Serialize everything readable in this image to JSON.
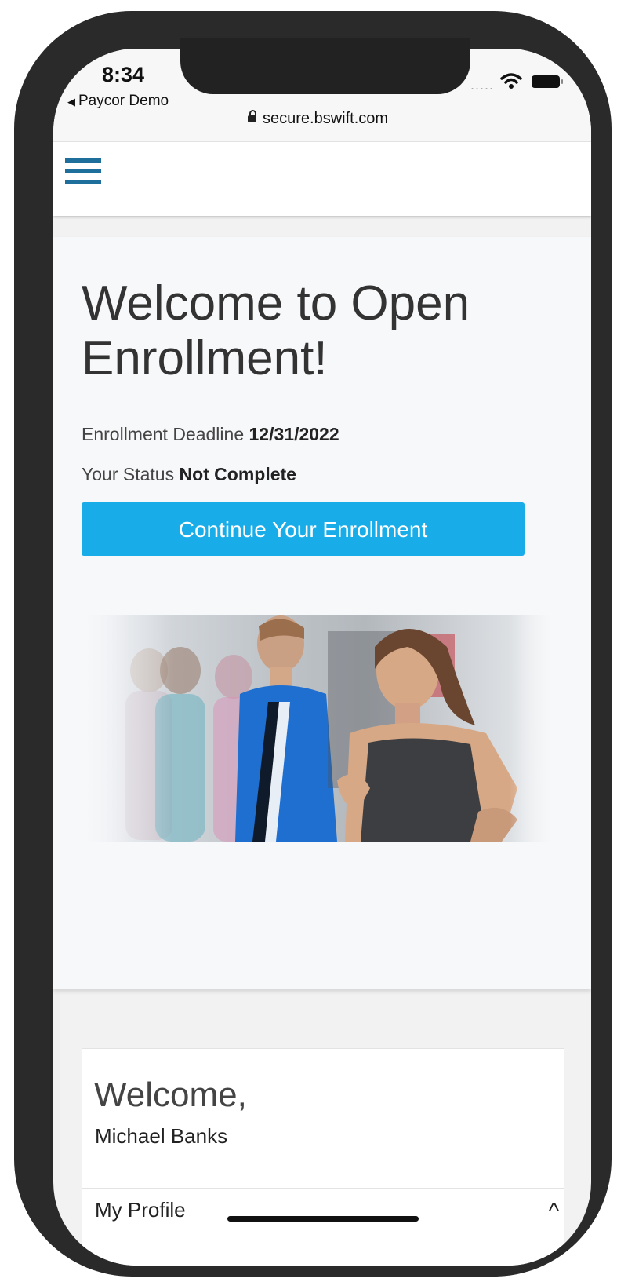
{
  "status_bar": {
    "time": "8:34",
    "back_app": "Paycor Demo",
    "url": "secure.bswift.com"
  },
  "hero": {
    "title": "Welcome to Open Enrollment!",
    "deadline_label": "Enrollment Deadline",
    "deadline_value": "12/31/2022",
    "status_label": "Your Status",
    "status_value": "Not Complete",
    "cta_label": "Continue Your Enrollment"
  },
  "welcome_card": {
    "title": "Welcome,",
    "name": "Michael Banks",
    "profile_label": "My Profile"
  },
  "colors": {
    "accent": "#18ace8",
    "menu_icon": "#1f6f9c"
  }
}
